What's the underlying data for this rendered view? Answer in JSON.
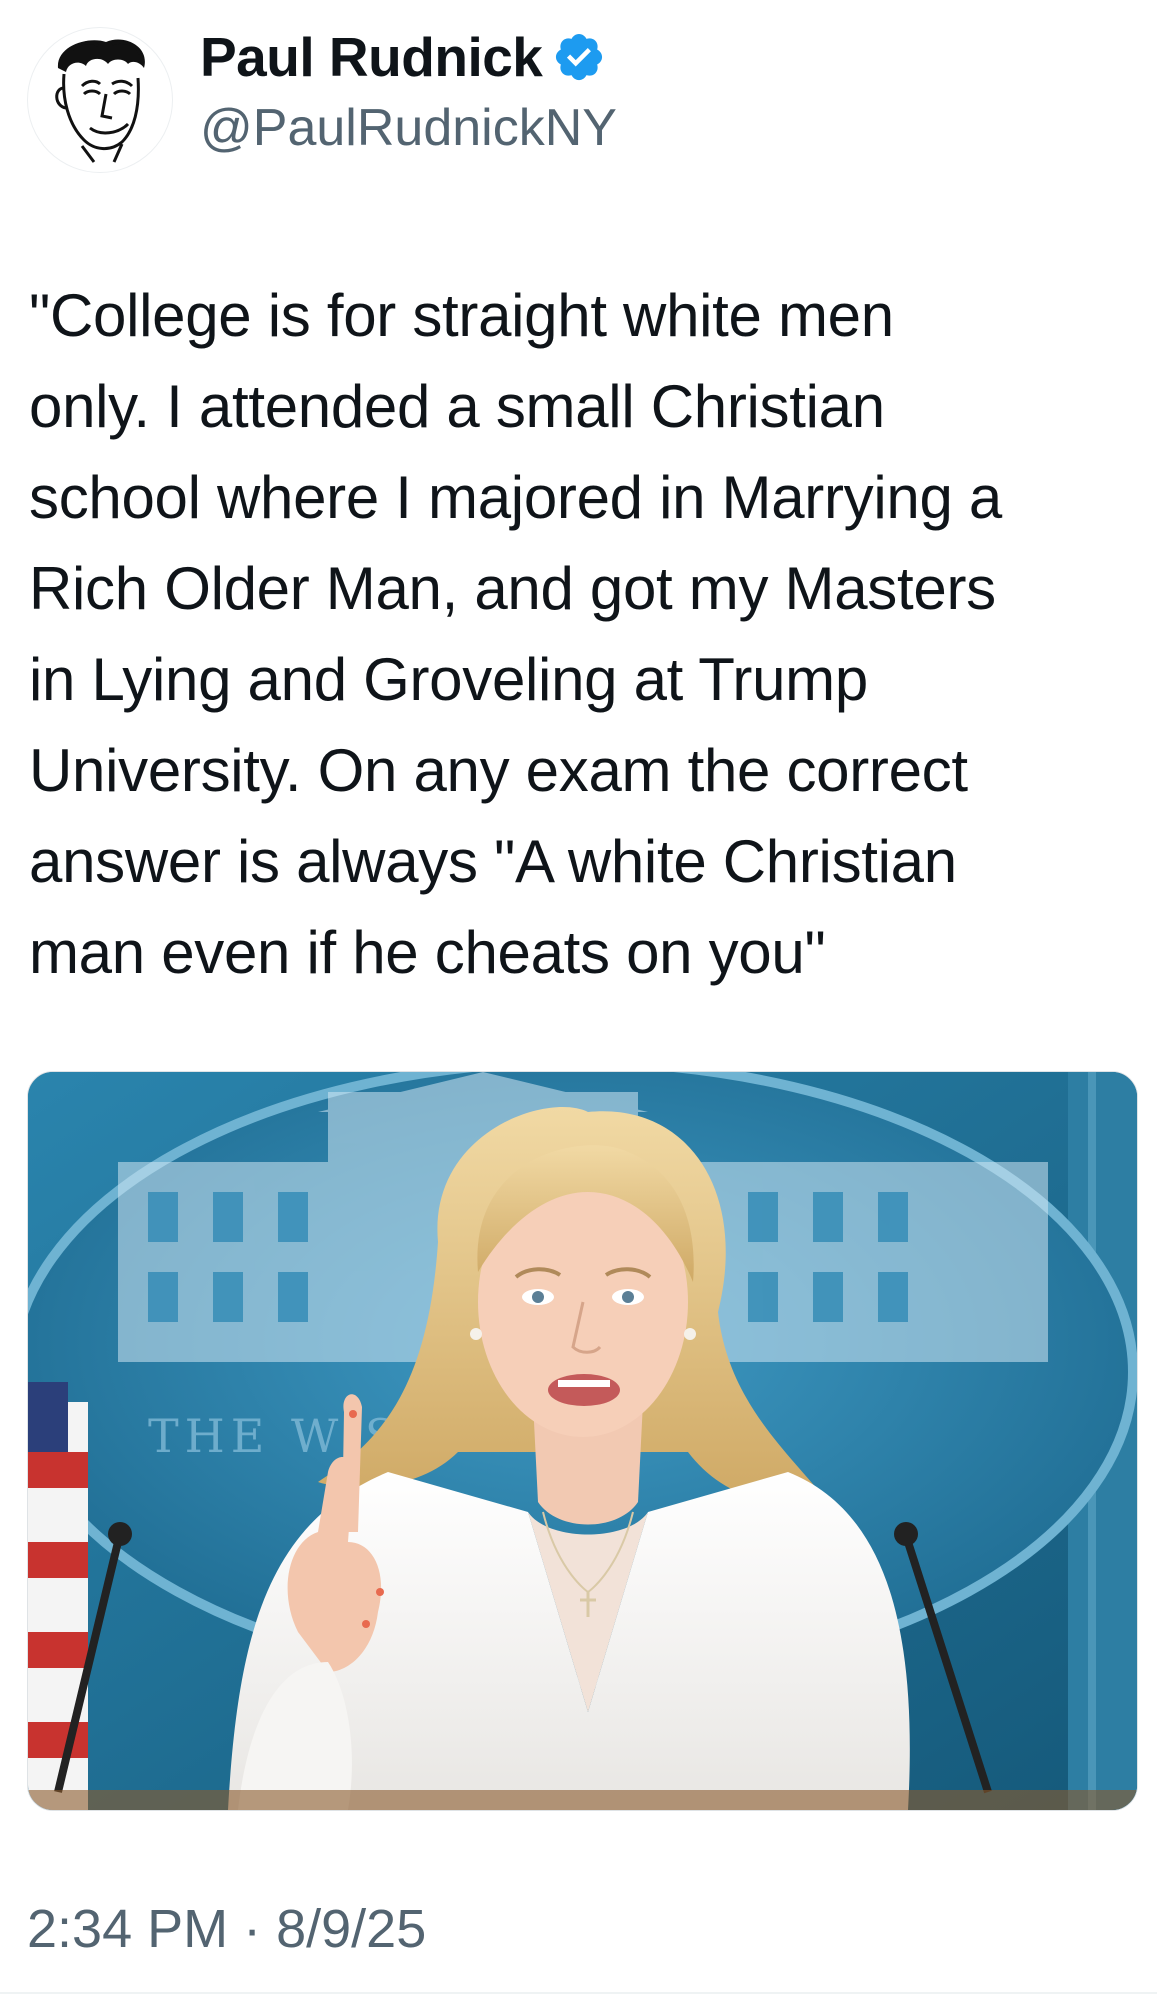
{
  "author": {
    "display_name": "Paul Rudnick",
    "handle": "@PaulRudnickNY",
    "verified": true,
    "avatar_icon": "cartoon-portrait-avatar"
  },
  "tweet": {
    "text_lines": [
      "\"College is for straight white men",
      "only. I attended a small Christian",
      "school where I majored in Marrying a",
      "Rich Older Man, and got my Masters",
      "in Lying and Groveling at Trump",
      "University. On any exam the correct",
      "answer is always \"A white Christian",
      "man even if he cheats on you\""
    ],
    "media": {
      "backdrop_text": "THE W          SE"
    },
    "timestamp": "2:34 PM · 8/9/25"
  },
  "colors": {
    "text_primary": "#0f1419",
    "text_secondary": "#536471",
    "verified_badge": "#1d9bf0"
  }
}
